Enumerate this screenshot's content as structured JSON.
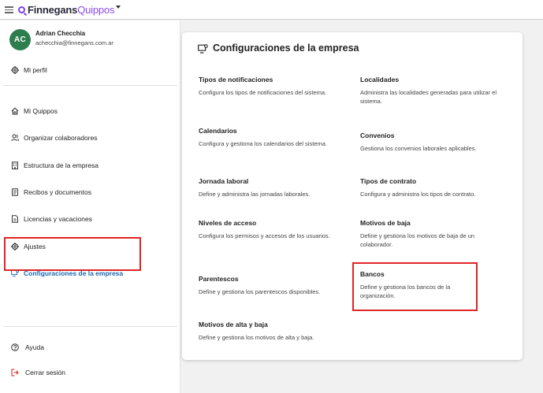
{
  "header": {
    "logo_part1": "Finnegans",
    "logo_part2": "Quippos"
  },
  "user": {
    "initials": "AC",
    "name": "Adrian Checchia",
    "email": "achecchia@finnegans.com.ar"
  },
  "sidebar": {
    "profile": "Mi perfil",
    "items": [
      {
        "label": "Mi Quippos",
        "icon": "home-icon"
      },
      {
        "label": "Organizar colaboradores",
        "icon": "users-icon"
      },
      {
        "label": "Estructura de la empresa",
        "icon": "building-icon"
      },
      {
        "label": "Recibos y documentos",
        "icon": "document-icon"
      },
      {
        "label": "Licencias y vacaciones",
        "icon": "calendar-document-icon"
      },
      {
        "label": "Ajustes",
        "icon": "gear-icon"
      },
      {
        "label": "Configuraciones de la empresa",
        "icon": "monitor-gear-icon",
        "active": true
      }
    ],
    "help": "Ayuda",
    "logout": "Cerrar sesión"
  },
  "main": {
    "title": "Configuraciones de la empresa",
    "left_column": [
      {
        "title": "Tipos de notificaciones",
        "desc": "Configura los tipos de notificaciones del sistema."
      },
      {
        "title": "Calendarios",
        "desc": "Configura y gestiona los calendarios del sistema."
      },
      {
        "title": "Jornada laboral",
        "desc": "Define y administra las jornadas laborales."
      },
      {
        "title": "Niveles de acceso",
        "desc": "Configura los permisos y accesos de los usuarios."
      },
      {
        "title": "Parentescos",
        "desc": "Define y gestiona los parentescos disponibles."
      },
      {
        "title": "Motivos de alta y baja",
        "desc": "Define y gestiona los motivos de alta y baja."
      }
    ],
    "right_column": [
      {
        "title": "Localidades",
        "desc": "Administra las localidades generadas para utilizar el sistema."
      },
      {
        "title": "Convenios",
        "desc": "Gestiona los convenios laborales aplicables."
      },
      {
        "title": "Tipos de contrato",
        "desc": "Configura y administra los tipos de contrato."
      },
      {
        "title": "Motivos de baja",
        "desc": "Define y gestiona los motivos de baja de un colaborador."
      },
      {
        "title": "Bancos",
        "desc": "Define y gestiona los bancos de la organización."
      }
    ]
  },
  "colors": {
    "accent": "#1a66b0",
    "brand": "#8a4df0",
    "avatar": "#2e7d4f",
    "highlight": "#e02424"
  }
}
